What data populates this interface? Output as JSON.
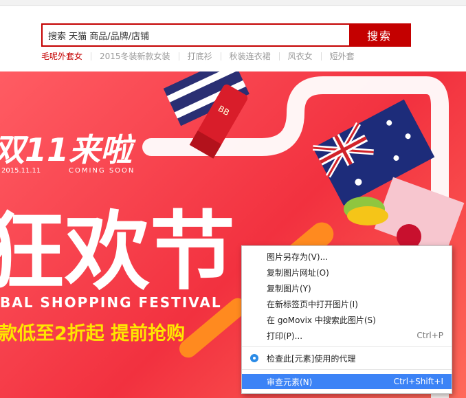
{
  "search": {
    "value": "搜索 天猫 商品/品牌/店铺",
    "button_label": "搜索"
  },
  "hot_words": [
    "毛呢外套女",
    "2015冬装新款女装",
    "打底衫",
    "秋装连衣裙",
    "风衣女",
    "短外套"
  ],
  "banner": {
    "headline": "双11来啦",
    "date": "2015.11.11",
    "coming": "COMING SOON",
    "big_title": "狂欢节",
    "subtitle": "BAL SHOPPING FESTIVAL",
    "promo": "款低至2折起 提前抢购",
    "product_label": "BB"
  },
  "context_menu": {
    "items": [
      {
        "label": "图片另存为(V)...",
        "shortcut": ""
      },
      {
        "label": "复制图片网址(O)",
        "shortcut": ""
      },
      {
        "label": "复制图片(Y)",
        "shortcut": ""
      },
      {
        "label": "在新标签页中打开图片(I)",
        "shortcut": ""
      },
      {
        "label": "在 goMovix 中搜索此图片(S)",
        "shortcut": ""
      },
      {
        "label": "打印(P)...",
        "shortcut": "Ctrl+P"
      },
      {
        "label": "检查此[元素]使用的代理",
        "shortcut": ""
      },
      {
        "label": "审查元素(N)",
        "shortcut": "Ctrl+Shift+I"
      }
    ]
  },
  "colors": {
    "brand": "#c40000",
    "banner": "#f2313f",
    "menu_highlight": "#3c83f6"
  }
}
